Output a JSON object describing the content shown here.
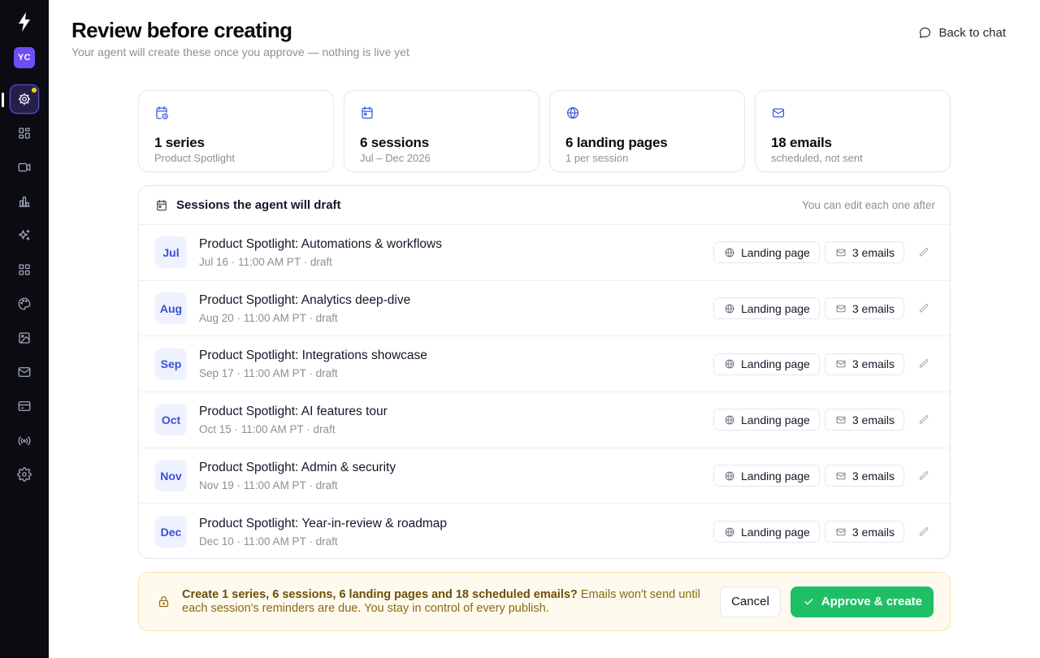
{
  "sidebar": {
    "avatar_initials": "YC",
    "items": [
      {
        "name": "agent",
        "icon": "gear-icon",
        "active": true
      },
      {
        "name": "dashboard",
        "icon": "grid-icon"
      },
      {
        "name": "video",
        "icon": "video-icon"
      },
      {
        "name": "analytics",
        "icon": "bar-chart-icon"
      },
      {
        "name": "ai",
        "icon": "sparkles-icon"
      },
      {
        "name": "apps",
        "icon": "grid-icon"
      },
      {
        "name": "branding",
        "icon": "palette-icon"
      },
      {
        "name": "media",
        "icon": "image-icon"
      },
      {
        "name": "email",
        "icon": "mail-icon"
      },
      {
        "name": "billing",
        "icon": "credit-card-icon"
      },
      {
        "name": "broadcast",
        "icon": "broadcast-icon"
      },
      {
        "name": "settings",
        "icon": "gear-icon"
      }
    ]
  },
  "header": {
    "title": "Review before creating",
    "subtitle": "Your agent will create these once you approve — nothing is live yet",
    "back_label": "Back to chat"
  },
  "stats": [
    {
      "icon": "calendar-clock-icon",
      "value": "1 series",
      "sub": "Product Spotlight"
    },
    {
      "icon": "calendar-icon",
      "value": "6 sessions",
      "sub": "Jul – Dec 2026"
    },
    {
      "icon": "globe-icon",
      "value": "6 landing pages",
      "sub": "1 per session"
    },
    {
      "icon": "mail-icon",
      "value": "18 emails",
      "sub": "scheduled, not sent"
    }
  ],
  "sessions_panel": {
    "title": "Sessions the agent will draft",
    "hint": "You can edit each one after",
    "landing_label": "Landing page",
    "emails_label": "3 emails",
    "rows": [
      {
        "month": "Jul",
        "title": "Product Spotlight: Automations & workflows",
        "meta": "Jul 16 · 11:00 AM PT · draft"
      },
      {
        "month": "Aug",
        "title": "Product Spotlight: Analytics deep-dive",
        "meta": "Aug 20 · 11:00 AM PT · draft"
      },
      {
        "month": "Sep",
        "title": "Product Spotlight: Integrations showcase",
        "meta": "Sep 17 · 11:00 AM PT · draft"
      },
      {
        "month": "Oct",
        "title": "Product Spotlight: AI features tour",
        "meta": "Oct 15 · 11:00 AM PT · draft"
      },
      {
        "month": "Nov",
        "title": "Product Spotlight: Admin & security",
        "meta": "Nov 19 · 11:00 AM PT · draft"
      },
      {
        "month": "Dec",
        "title": "Product Spotlight: Year-in-review & roadmap",
        "meta": "Dec 10 · 11:00 AM PT · draft"
      }
    ]
  },
  "confirm": {
    "question": "Create 1 series, 6 sessions, 6 landing pages and 18 scheduled emails?",
    "note": " Emails won't send until each session's reminders are due. You stay in control of every publish.",
    "cancel_label": "Cancel",
    "approve_label": "Approve & create"
  },
  "colors": {
    "sidebar_bg": "#0b0b12",
    "accent": "#3b5bdb",
    "approve": "#1fbf68",
    "banner_bg": "#fffaee",
    "banner_text": "#8a6a10",
    "avatar": "#6d4df6"
  }
}
